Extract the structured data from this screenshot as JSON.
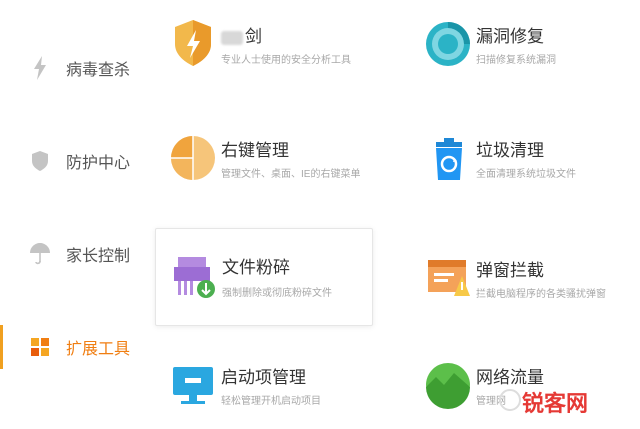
{
  "sidebar": {
    "items": [
      {
        "label": "病毒查杀",
        "icon": "lightning-icon",
        "active": false
      },
      {
        "label": "防护中心",
        "icon": "shield-icon",
        "active": false
      },
      {
        "label": "家长控制",
        "icon": "umbrella-icon",
        "active": false
      },
      {
        "label": "扩展工具",
        "icon": "toolbox-icon",
        "active": true
      }
    ]
  },
  "tools": {
    "security_analysis": {
      "name": "剑",
      "desc": "专业人士使用的安全分析工具",
      "icon": "sword-shield-icon"
    },
    "vuln_repair": {
      "name": "漏洞修复",
      "desc": "扫描修复系统漏洞",
      "icon": "vulnerability-repair-icon"
    },
    "context_menu": {
      "name": "右键管理",
      "desc": "管理文件、桌面、IE的右键菜单",
      "icon": "context-menu-icon"
    },
    "junk_clean": {
      "name": "垃圾清理",
      "desc": "全面清理系统垃圾文件",
      "icon": "trash-bin-icon"
    },
    "file_shred": {
      "name": "文件粉碎",
      "desc": "强制删除或彻底粉碎文件",
      "icon": "shredder-icon"
    },
    "popup_block": {
      "name": "弹窗拦截",
      "desc": "拦截电脑程序的各类骚扰弹窗",
      "icon": "popup-block-icon"
    },
    "startup_mgr": {
      "name": "启动项管理",
      "desc": "轻松管理开机启动项目",
      "icon": "monitor-startup-icon"
    },
    "net_traffic": {
      "name": "网络流量",
      "desc": "管理网",
      "icon": "network-traffic-icon"
    }
  },
  "watermark": {
    "text": "锐客网"
  },
  "colors": {
    "accent": "#f07e12",
    "highlight_bar": "#f0a020",
    "watermark": "#e53935"
  }
}
